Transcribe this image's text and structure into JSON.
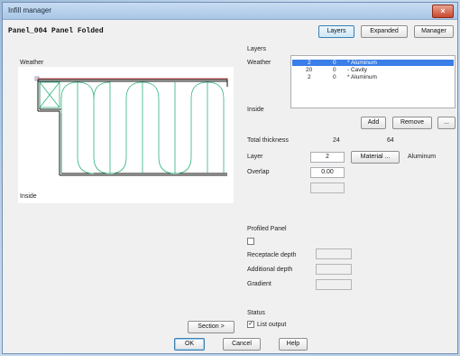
{
  "window": {
    "title": "Infill manager",
    "close_glyph": "×"
  },
  "panel_title": "Panel_004 Panel Folded",
  "tabs": {
    "layers": "Layers",
    "expanded": "Expanded",
    "manager": "Manager",
    "active": "layers"
  },
  "preview": {
    "weather_label": "Weather",
    "inside_label": "Inside"
  },
  "layers": {
    "heading": "Layers",
    "weather_label": "Weather",
    "inside_label": "Inside",
    "rows": [
      {
        "c1": "2",
        "c2": "0",
        "c3": "* Aluminum",
        "selected": true
      },
      {
        "c1": "20",
        "c2": "0",
        "c3": "- Cavity",
        "selected": false
      },
      {
        "c1": "2",
        "c2": "0",
        "c3": "* Aluminum",
        "selected": false
      }
    ],
    "add_button": "Add",
    "remove_button": "Remove",
    "more_button": "..."
  },
  "totals": {
    "label": "Total thickness",
    "value1": "24",
    "value2": "64"
  },
  "layer_field": {
    "label": "Layer",
    "value": "2",
    "material_button": "Material ...",
    "material_value": "Aluminum"
  },
  "overlap": {
    "label": "Overlap",
    "value": "0.00",
    "extra_value": ""
  },
  "profiled": {
    "heading": "Profiled Panel",
    "checked": false,
    "receptacle_label": "Receptacle depth",
    "receptacle_value": "",
    "additional_label": "Additional depth",
    "additional_value": "",
    "gradient_label": "Gradient",
    "gradient_value": ""
  },
  "status": {
    "heading": "Status",
    "list_output_label": "List output",
    "list_output_checked": true
  },
  "section_button": "Section >",
  "buttons": {
    "ok": "OK",
    "cancel": "Cancel",
    "help": "Help"
  },
  "colors": {
    "selection": "#3a7ee8",
    "insulation": "#2fb37a",
    "outline": "#111111",
    "weather_line": "#d23a3a"
  }
}
